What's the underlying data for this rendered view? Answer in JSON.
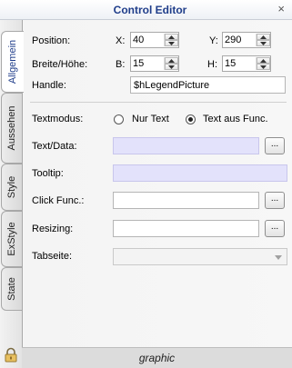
{
  "window": {
    "title": "Control Editor",
    "close_glyph": "×"
  },
  "tabs": [
    {
      "label": "Allgemein",
      "active": true
    },
    {
      "label": "Aussehen",
      "active": false
    },
    {
      "label": "Style",
      "active": false
    },
    {
      "label": "ExStyle",
      "active": false
    },
    {
      "label": "State",
      "active": false
    }
  ],
  "position": {
    "label": "Position:",
    "x_label": "X:",
    "x_value": "40",
    "y_label": "Y:",
    "y_value": "290"
  },
  "size": {
    "label": "Breite/Höhe:",
    "b_label": "B:",
    "b_value": "15",
    "h_label": "H:",
    "h_value": "15"
  },
  "handle": {
    "label": "Handle:",
    "value": "$hLegendPicture"
  },
  "textmodus": {
    "label": "Textmodus:",
    "options": [
      {
        "label": "Nur Text",
        "checked": false
      },
      {
        "label": "Text aus Func.",
        "checked": true
      }
    ]
  },
  "text_data": {
    "label": "Text/Data:",
    "value": "",
    "button": "..."
  },
  "tooltip": {
    "label": "Tooltip:",
    "value": ""
  },
  "click_func": {
    "label": "Click Func.:",
    "value": "",
    "button": "..."
  },
  "resizing": {
    "label": "Resizing:",
    "value": "",
    "button": "..."
  },
  "tabseite": {
    "label": "Tabseite:",
    "value": ""
  },
  "footer": {
    "text": "graphic"
  },
  "icons": {
    "lock": "lock-icon",
    "spin_up": "chevron-up-icon",
    "spin_down": "chevron-down-icon",
    "dropdown": "dropdown-arrow-icon"
  },
  "colors": {
    "title": "#1f3d8a",
    "tinted_field": "#e3e2fb"
  }
}
